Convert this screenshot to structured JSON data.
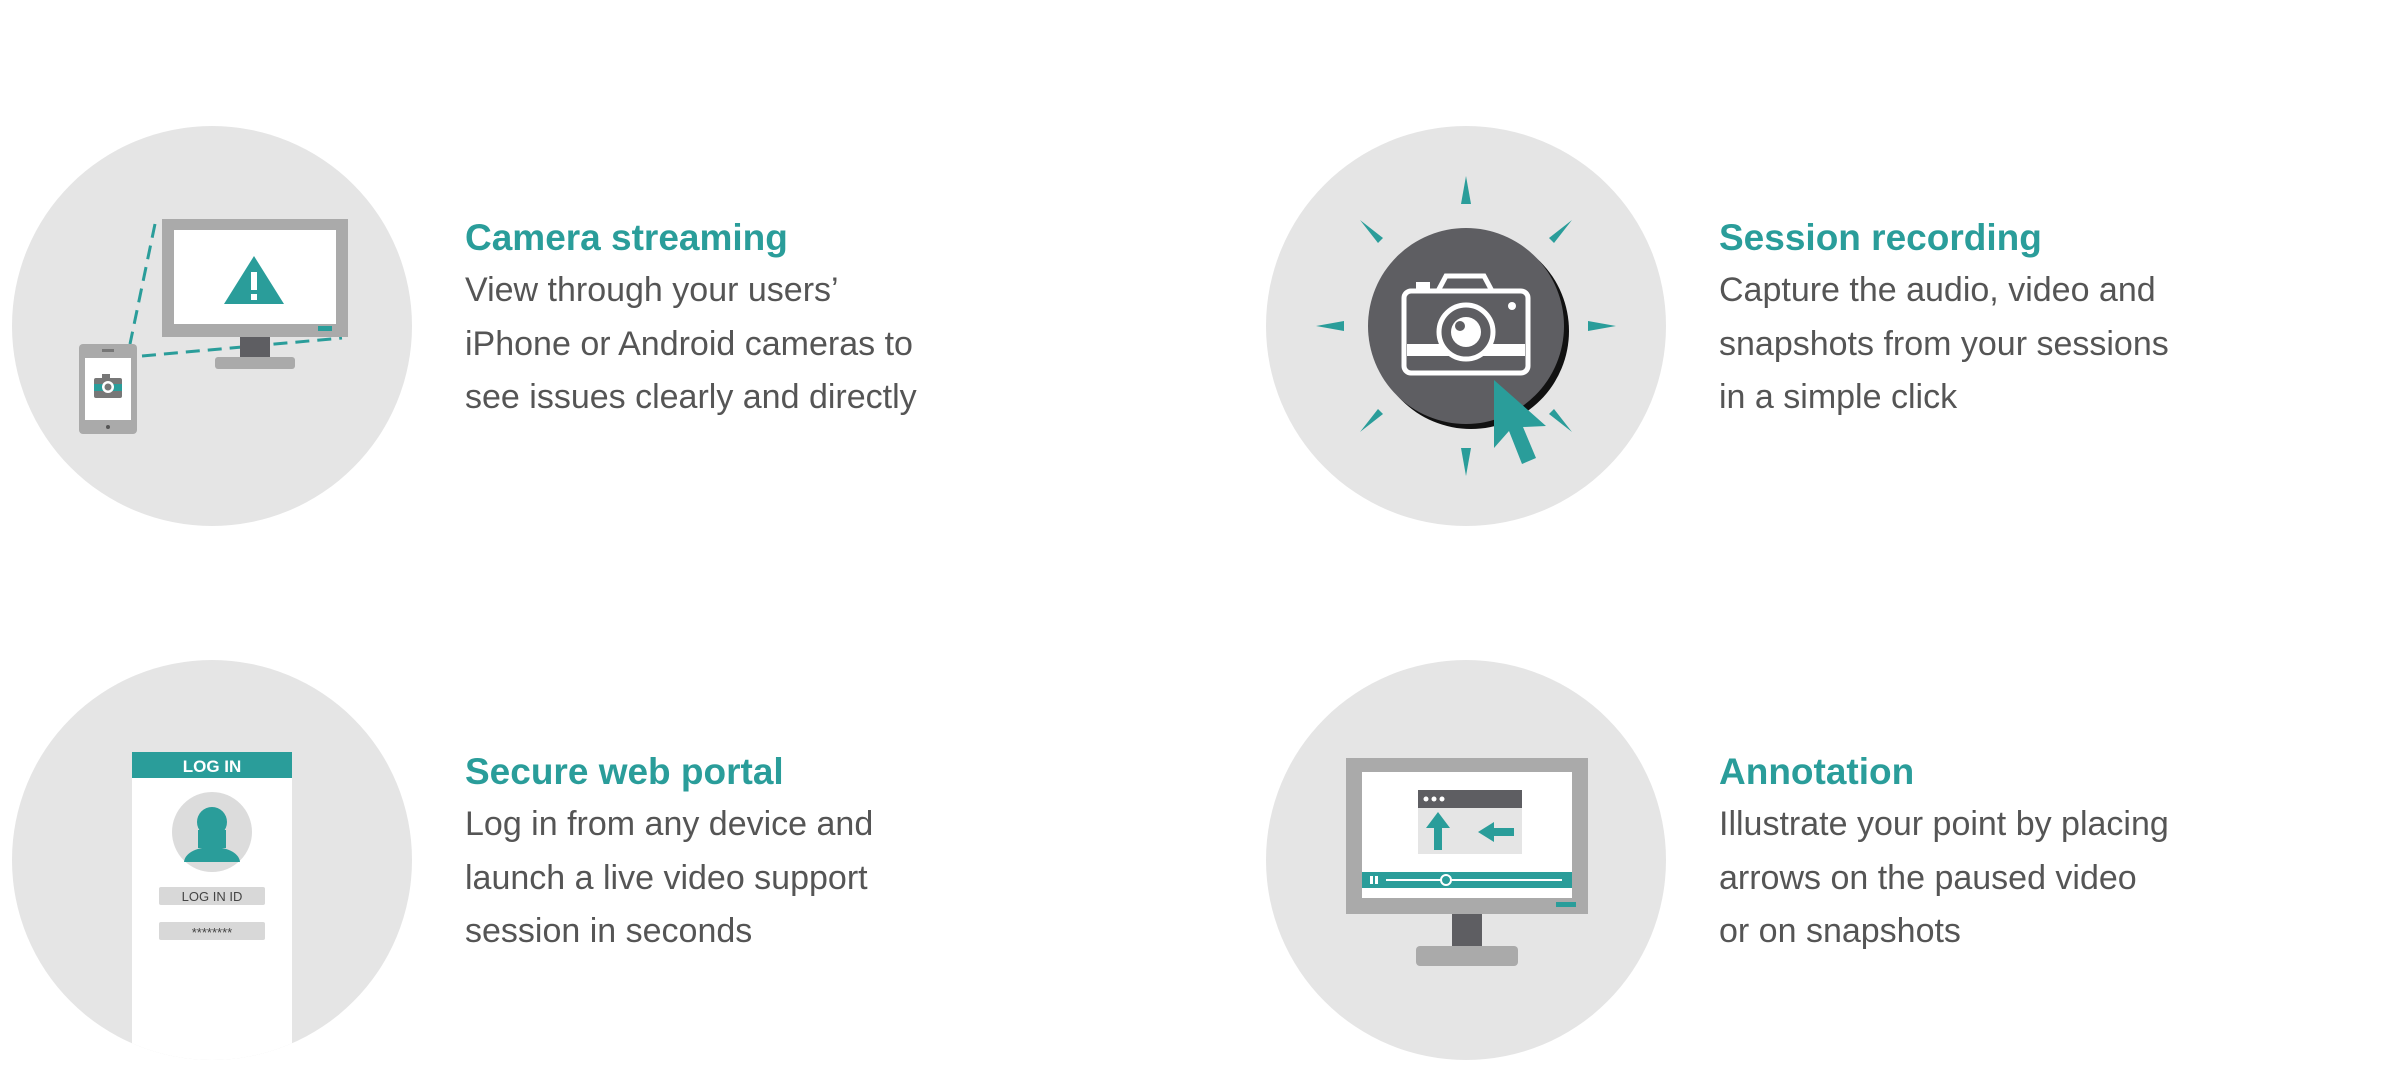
{
  "features": [
    {
      "title": "Camera streaming",
      "icon": "camera-streaming-icon",
      "description_lines": [
        "View through your users’",
        "iPhone or Android cameras to",
        "see issues clearly and directly"
      ]
    },
    {
      "title": "Session recording",
      "icon": "session-recording-icon",
      "description_lines": [
        "Capture the audio, video and",
        "snapshots from your sessions",
        "in a simple click"
      ]
    },
    {
      "title": "Secure web portal",
      "icon": "secure-web-portal-icon",
      "login_header": "LOG IN",
      "login_id_label": "LOG IN ID",
      "password_mask": "********",
      "description_lines": [
        "Log in from any device and",
        "launch a live video support",
        "session in seconds"
      ]
    },
    {
      "title": "Annotation",
      "icon": "annotation-icon",
      "description_lines": [
        "Illustrate your point by placing",
        "arrows on the paused video",
        "or on snapshots"
      ]
    }
  ],
  "colors": {
    "accent": "#2a9d9a",
    "body_text": "#555555",
    "circle_background": "#e5e5e5",
    "device_gray": "#aaaaaa",
    "dark_gray": "#5e5e62"
  }
}
